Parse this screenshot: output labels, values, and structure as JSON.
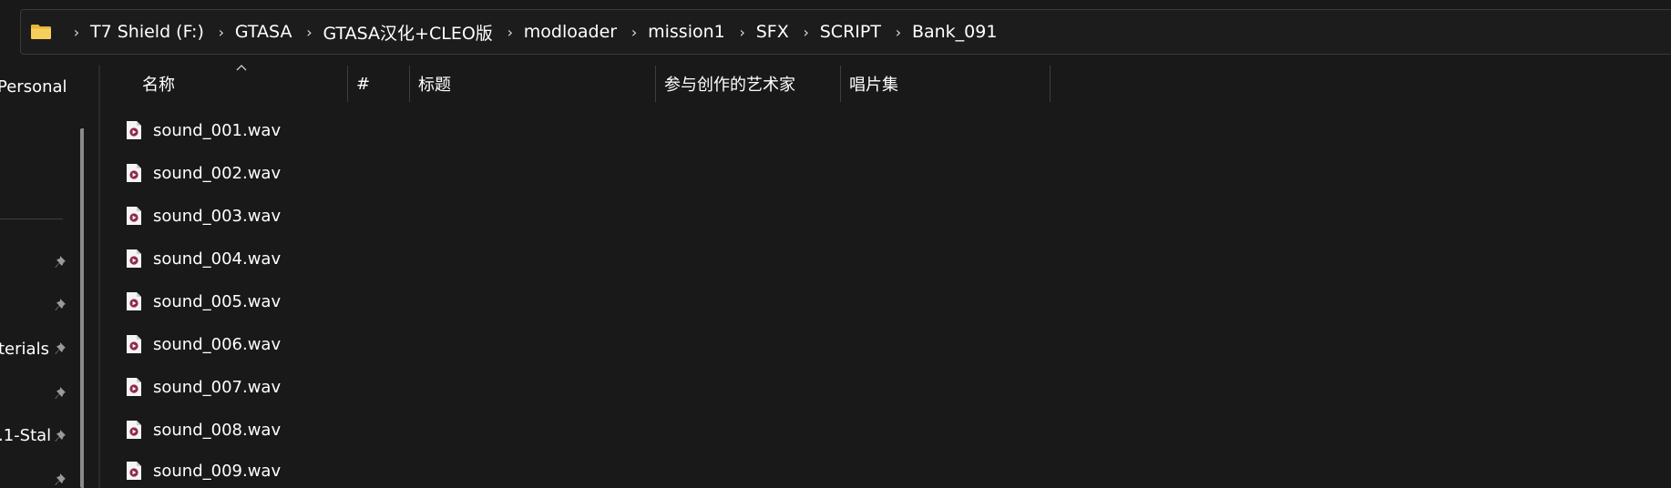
{
  "address_bar": {
    "folder_icon": "folder-icon",
    "crumbs": [
      "T7 Shield (F:)",
      "GTASA",
      "GTASA汉化+CLEO版",
      "modloader",
      "mission1",
      "SFX",
      "SCRIPT",
      "Bank_091"
    ],
    "separator_icon": "chevron-right-icon"
  },
  "sidebar": {
    "items": [
      {
        "label": "Personal"
      },
      {
        "label": "terials",
        "pinned": true
      },
      {
        "label": ".1-Stal",
        "pinned": true
      }
    ],
    "pin_icon": "pin-icon"
  },
  "columns": {
    "name": "名称",
    "number": "#",
    "title": "标题",
    "contributing_artists": "参与创作的艺术家",
    "album": "唱片集",
    "sort_icon": "sort-ascending-icon"
  },
  "files": [
    {
      "name": "sound_001.wav",
      "icon": "audio-file-icon"
    },
    {
      "name": "sound_002.wav",
      "icon": "audio-file-icon"
    },
    {
      "name": "sound_003.wav",
      "icon": "audio-file-icon"
    },
    {
      "name": "sound_004.wav",
      "icon": "audio-file-icon"
    },
    {
      "name": "sound_005.wav",
      "icon": "audio-file-icon"
    },
    {
      "name": "sound_006.wav",
      "icon": "audio-file-icon"
    },
    {
      "name": "sound_007.wav",
      "icon": "audio-file-icon"
    },
    {
      "name": "sound_008.wav",
      "icon": "audio-file-icon"
    },
    {
      "name": "sound_009.wav",
      "icon": "audio-file-icon"
    }
  ],
  "colors": {
    "background": "#191919",
    "folder": "#f2c14e",
    "media_badge": "#8e2a4a"
  }
}
